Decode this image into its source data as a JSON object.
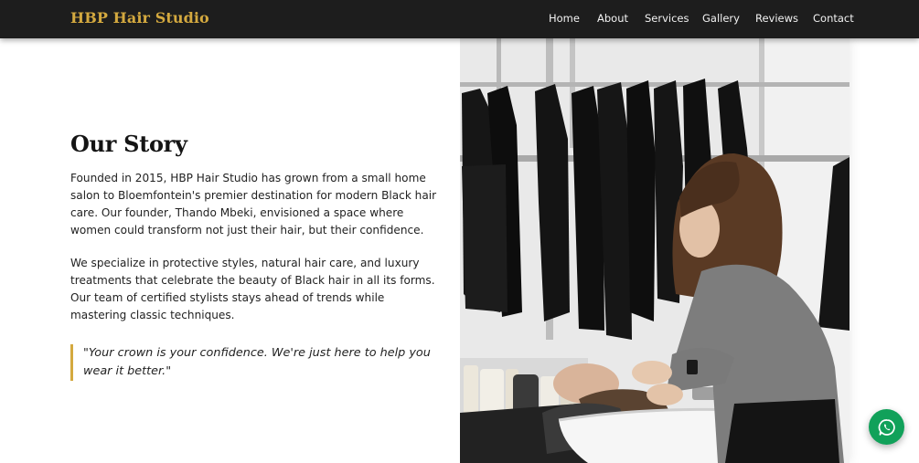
{
  "header": {
    "brand": "HBP Hair Studio",
    "nav": [
      {
        "label": "Home"
      },
      {
        "label": "About"
      },
      {
        "label": "Services"
      },
      {
        "label": "Gallery"
      },
      {
        "label": "Reviews"
      },
      {
        "label": "Contact"
      }
    ]
  },
  "story": {
    "title": "Our Story",
    "paragraph_1": "Founded in 2015, HBP Hair Studio has grown from a small home salon to Bloemfontein's premier destination for modern Black hair care. Our founder, Thando Mbeki, envisioned a space where women could transform not just their hair, but their confidence.",
    "paragraph_2": "We specialize in protective styles, natural hair care, and luxury treatments that celebrate the beauty of Black hair in all its forms. Our team of certified stylists stays ahead of trends while mastering classic techniques.",
    "quote": "\"Your crown is your confidence. We're just here to help you wear it better.\""
  },
  "floating": {
    "chat_icon": "whatsapp-icon"
  },
  "colors": {
    "accent_gold": "#d4a93f",
    "navbar_bg": "#1d1d1d",
    "whatsapp_green": "#11a15a"
  }
}
